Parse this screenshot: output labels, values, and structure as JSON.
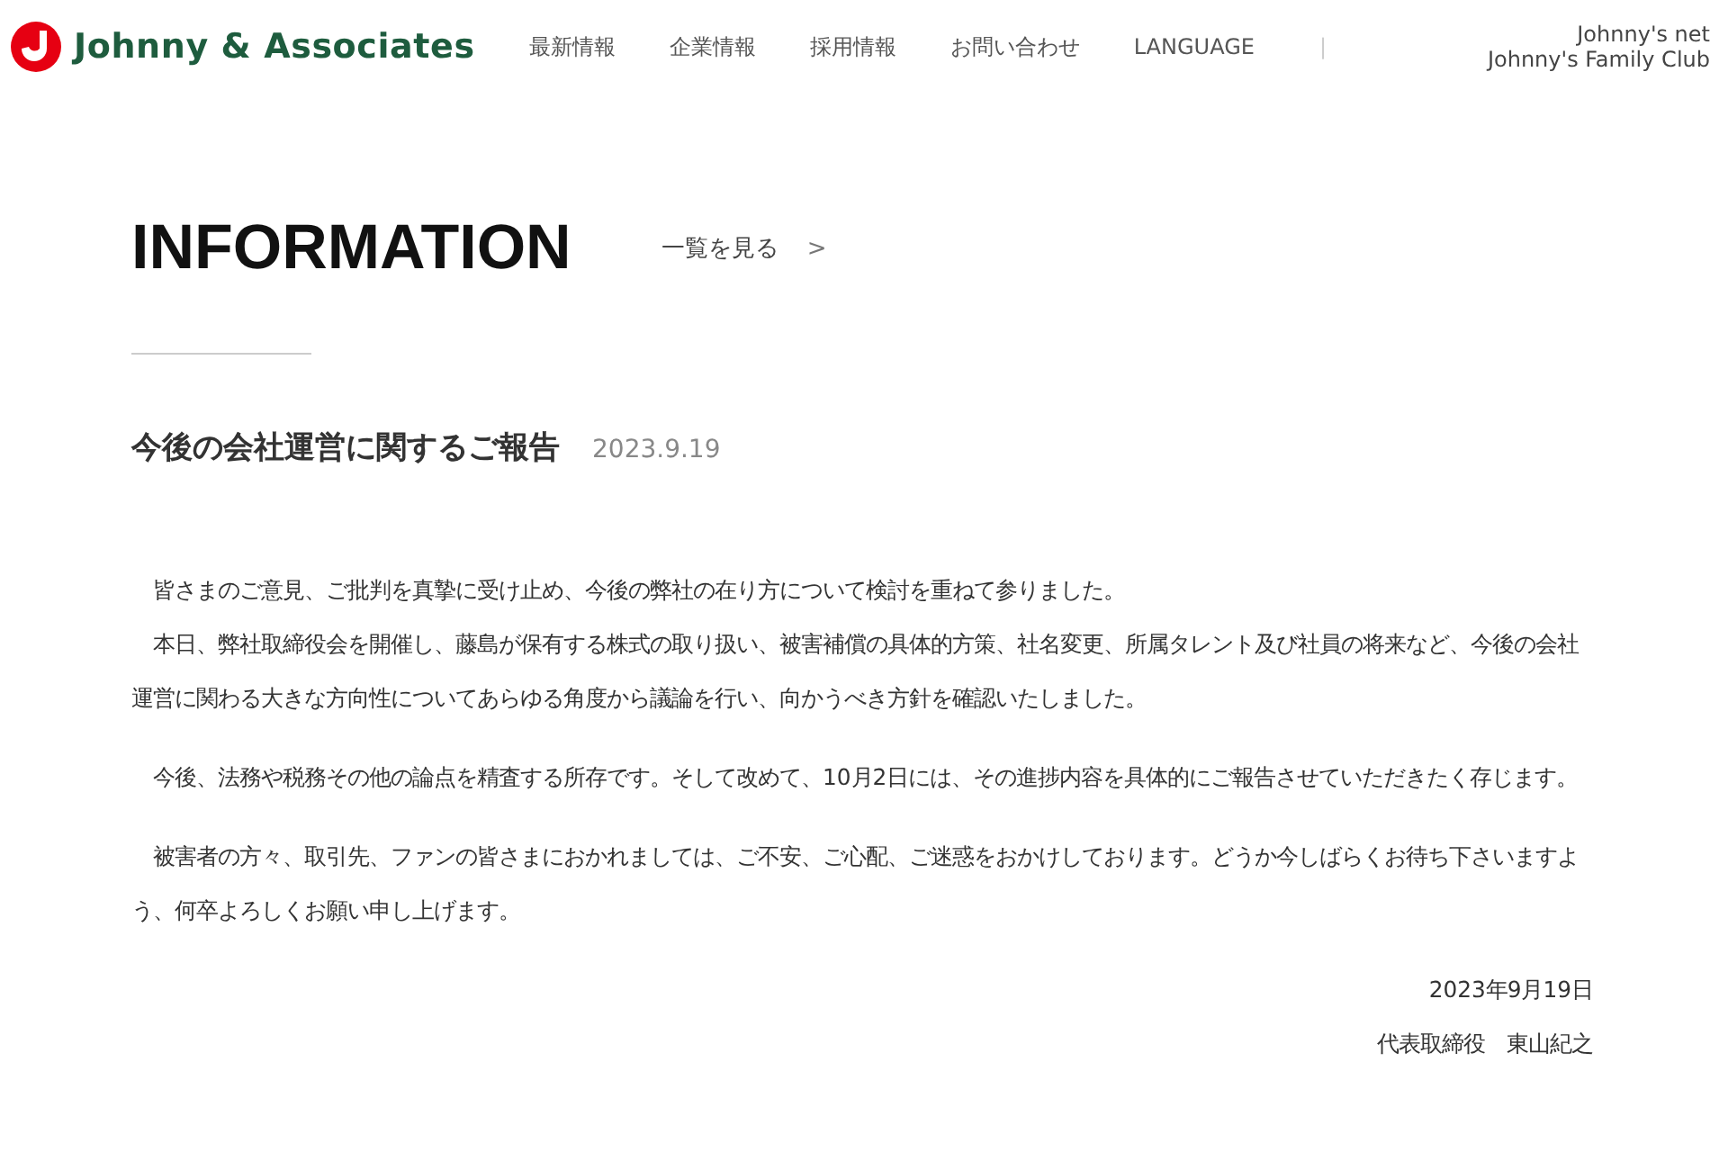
{
  "header": {
    "logo": "Johnny & Associates",
    "nav": [
      "最新情報",
      "企業情報",
      "採用情報",
      "お問い合わせ",
      "LANGUAGE"
    ],
    "separator": "|",
    "external_links": [
      "Johnny's net",
      "Johnny's Family Club"
    ]
  },
  "section": {
    "heading": "INFORMATION",
    "view_all": "一覧を見る",
    "arrow": ">"
  },
  "article": {
    "title": "今後の会社運営に関するご報告",
    "date": "2023.9.19",
    "paragraphs": [
      [
        "　皆さまのご意見、ご批判を真摯に受け止め、今後の弊社の在り方について検討を重ねて参りました。",
        "　本日、弊社取締役会を開催し、藤島が保有する株式の取り扱い、被害補償の具体的方策、社名変更、所属タレント及び社員の将来など、今後の会社運営に関わる大きな方向性についてあらゆる角度から議論を行い、向かうべき方針を確認いたしました。"
      ],
      [
        "　今後、法務や税務その他の論点を精査する所存です。そして改めて、10月2日には、その進捗内容を具体的にご報告させていただきたく存じます。"
      ],
      [
        "　被害者の方々、取引先、ファンの皆さまにおかれましては、ご不安、ご心配、ご迷惑をおかけしております。どうか今しばらくお待ち下さいますよう、何卒よろしくお願い申し上げます。"
      ]
    ],
    "signature": [
      "2023年9月19日",
      "代表取締役　東山紀之"
    ]
  }
}
